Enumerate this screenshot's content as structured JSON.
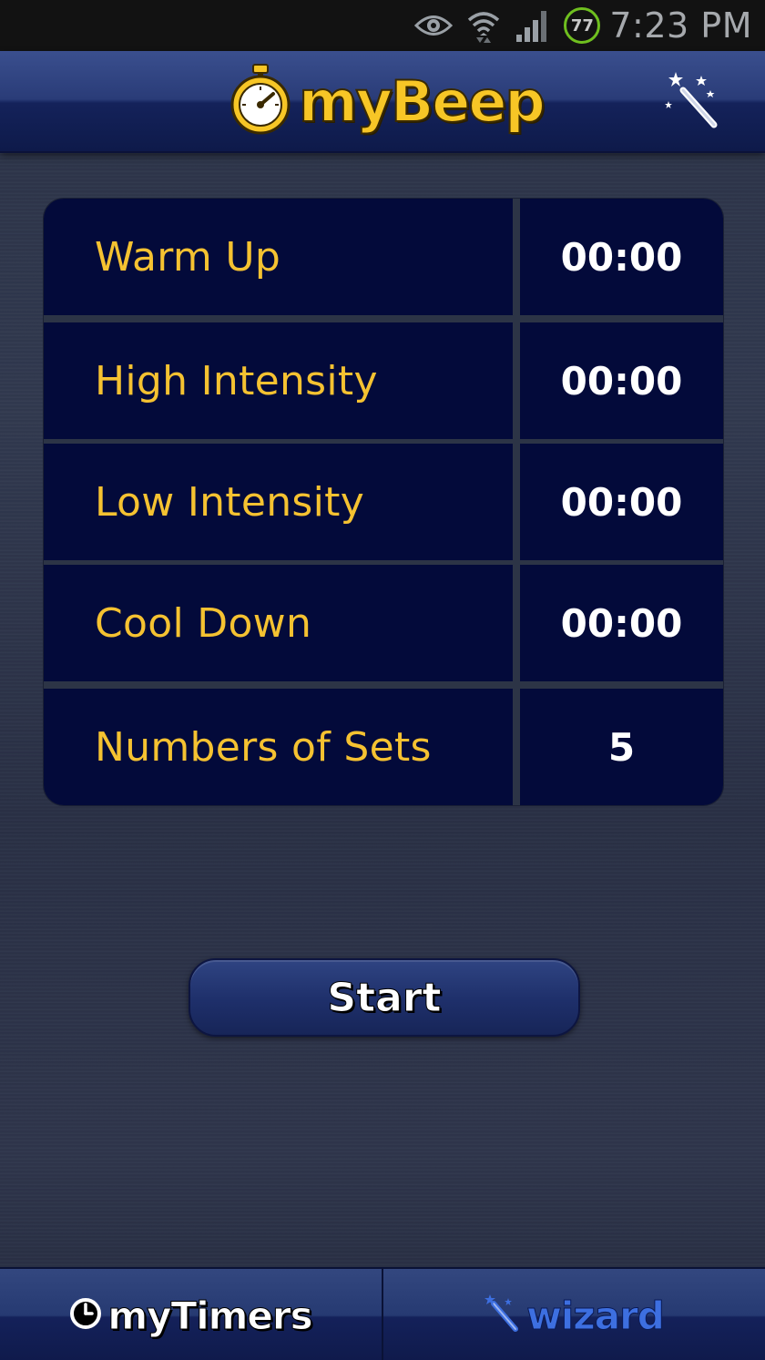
{
  "status_bar": {
    "battery_level": "77",
    "time": "7:23 PM"
  },
  "header": {
    "logo_text": "myBeep",
    "icons": [
      "stopwatch-icon",
      "magic-wand-icon"
    ]
  },
  "settings": {
    "rows": [
      {
        "label": "Warm Up",
        "value": "00:00"
      },
      {
        "label": "High Intensity",
        "value": "00:00"
      },
      {
        "label": "Low Intensity",
        "value": "00:00"
      },
      {
        "label": "Cool Down",
        "value": "00:00"
      },
      {
        "label": "Numbers of Sets",
        "value": "5"
      }
    ]
  },
  "start_button": {
    "label": "Start"
  },
  "tabs": [
    {
      "label": "myTimers",
      "icon": "clock-icon"
    },
    {
      "label": "wizard",
      "icon": "magic-wand-icon"
    }
  ],
  "colors": {
    "accent_yellow": "#f5c231",
    "panel_navy": "#030a3a",
    "header_blue": "#2a3c78",
    "wizard_blue": "#3d6fe0"
  }
}
